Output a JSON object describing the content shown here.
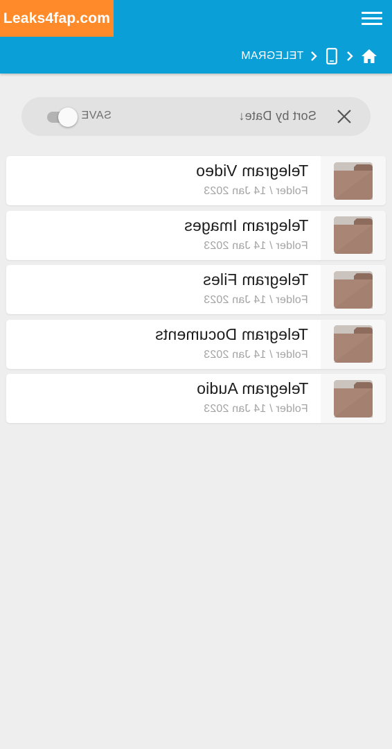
{
  "watermark": {
    "text": "Leaks4fap.com"
  },
  "header": {
    "background_color": "#0b9fd8",
    "menu_icon": "hamburger-menu-icon",
    "breadcrumb": {
      "home_icon": "home-icon",
      "separator_icon": "chevron-icon",
      "device_icon": "phone-device-icon",
      "current": "TELEGRAM"
    }
  },
  "sortbar": {
    "sort_label": "Sort by Date↓",
    "save_label": "SAVE",
    "save_toggle_on": false,
    "close_icon": "close-icon"
  },
  "folders": [
    {
      "name": "Telegram Video",
      "meta": "Folder / 14 Jan 2023",
      "icon": "folder-icon"
    },
    {
      "name": "Telegram Images",
      "meta": "Folder / 14 Jan 2023",
      "icon": "folder-icon"
    },
    {
      "name": "Telegram Files",
      "meta": "Folder / 14 Jan 2023",
      "icon": "folder-icon"
    },
    {
      "name": "Telegram Documents",
      "meta": "Folder / 14 Jan 2023",
      "icon": "folder-icon"
    },
    {
      "name": "Telegram Audio",
      "meta": "Folder / 14 Jan 2023",
      "icon": "folder-icon"
    }
  ],
  "colors": {
    "accent": "#0b9fd8",
    "watermark": "#ff8a2a",
    "folder": "#a98575"
  }
}
